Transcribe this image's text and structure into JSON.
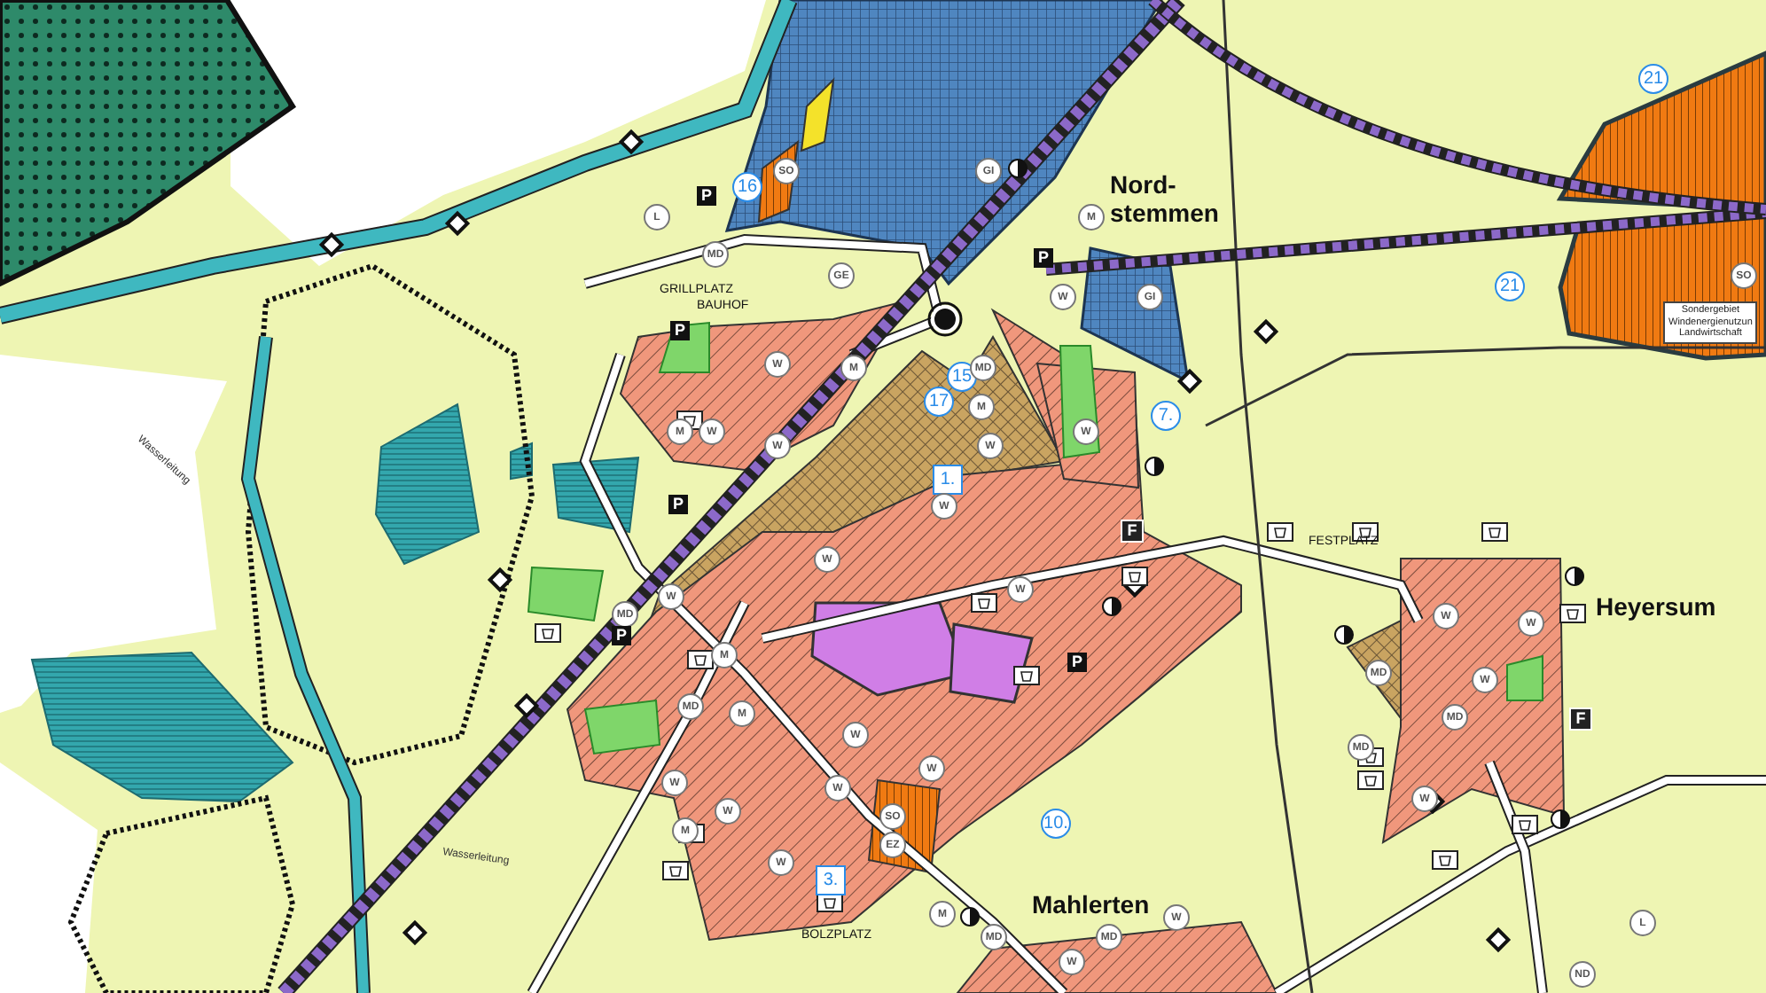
{
  "map": {
    "place_names": [
      {
        "lines": [
          "Nord-",
          "stemmen"
        ]
      },
      {
        "lines": [
          "Heyersum"
        ]
      },
      {
        "lines": [
          "Mahlerten"
        ]
      }
    ],
    "facility_labels": [
      "GRILLPLATZ",
      "BAUHOF",
      "FESTPLATZ",
      "BOLZPLATZ"
    ],
    "line_labels": [
      "Wasserleitung",
      "Wasserleitung"
    ],
    "change_numbers": [
      {
        "text": "16",
        "kind": "circle"
      },
      {
        "text": "15",
        "kind": "circle"
      },
      {
        "text": "17",
        "kind": "circle"
      },
      {
        "text": "7.",
        "kind": "circle"
      },
      {
        "text": "1.",
        "kind": "square"
      },
      {
        "text": "3.",
        "kind": "square"
      },
      {
        "text": "10.",
        "kind": "circle"
      },
      {
        "text": "21",
        "kind": "circle"
      },
      {
        "text": "21",
        "kind": "circle"
      }
    ],
    "zone_codes": [
      "SO",
      "GI",
      "L",
      "M",
      "MD",
      "GE",
      "SO",
      "W",
      "GI",
      "W",
      "M",
      "MD",
      "M",
      "M",
      "W",
      "W",
      "W",
      "W",
      "W",
      "W",
      "W",
      "W",
      "MD",
      "W",
      "W",
      "M",
      "MD",
      "W",
      "MD",
      "M",
      "MD",
      "W",
      "MD",
      "W",
      "W",
      "W",
      "W",
      "W",
      "SO",
      "M",
      "EZ",
      "W",
      "M",
      "W",
      "L",
      "MD",
      "MD",
      "W",
      "ND"
    ],
    "signs": [
      {
        "kind": "parking",
        "text": "P"
      },
      {
        "kind": "parking",
        "text": "P"
      },
      {
        "kind": "parking",
        "text": "P"
      },
      {
        "kind": "parking",
        "text": "P"
      },
      {
        "kind": "parking",
        "text": "P"
      },
      {
        "kind": "parking",
        "text": "P"
      },
      {
        "kind": "fire",
        "text": "F"
      },
      {
        "kind": "fire",
        "text": "F"
      }
    ],
    "legend_box": {
      "lines": [
        "Sondergebiet",
        "Windenergienutzun",
        "Landwirtschaft"
      ]
    }
  }
}
